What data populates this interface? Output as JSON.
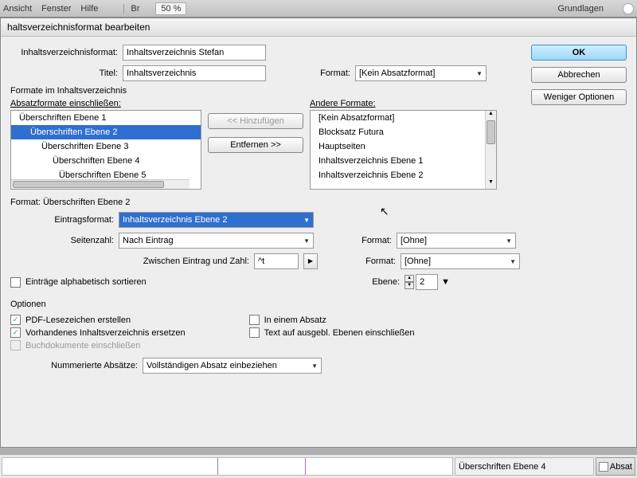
{
  "menubar": {
    "items": [
      "Ansicht",
      "Fenster",
      "Hilfe"
    ],
    "right_label": "Grundlagen",
    "zoom": "50 %"
  },
  "dialog": {
    "title": "haltsverzeichnisformat bearbeiten",
    "labels": {
      "tocFormat": "Inhaltsverzeichnisformat:",
      "title": "Titel:",
      "format": "Format:",
      "section1": "Formate im Inhaltsverzeichnis",
      "include": "Absatzformate einschließen:",
      "other": "Andere Formate:",
      "addBtn": "<< Hinzufügen",
      "removeBtn": "Entfernen >>",
      "formatPrefix": "Format: ",
      "entryFormat": "Eintragsformat:",
      "pageNum": "Seitenzahl:",
      "between": "Zwischen Eintrag und Zahl:",
      "level": "Ebene:",
      "alphaSort": "Einträge alphabetisch sortieren",
      "options": "Optionen",
      "pdf": "PDF-Lesezeichen erstellen",
      "replace": "Vorhandenes Inhaltsverzeichnis ersetzen",
      "bookdocs": "Buchdokumente einschließen",
      "singlePara": "In einem Absatz",
      "hiddenLayers": "Text auf ausgebl. Ebenen einschließen",
      "numPara": "Nummerierte Absätze:"
    },
    "values": {
      "tocFormat": "Inhaltsverzeichnis Stefan",
      "title": "Inhaltsverzeichnis",
      "format": "[Kein Absatzformat]",
      "selectedInclude": "Überschriften Ebene 2",
      "entryFormat": "Inhaltsverzeichnis Ebene 2",
      "pageNum": "Nach Eintrag",
      "between": "^t",
      "subFormat": "[Ohne]",
      "level": "2",
      "numPara": "Vollständigen Absatz einbeziehen"
    },
    "includeList": [
      "Überschriften Ebene 1",
      "Überschriften Ebene 2",
      "Überschriften Ebene 3",
      "Überschriften Ebene 4",
      "Überschriften Ebene 5"
    ],
    "otherList": [
      "[Kein Absatzformat]",
      "Blocksatz Futura",
      "Hauptseiten",
      "Inhaltsverzeichnis Ebene 1",
      "Inhaltsverzeichnis Ebene 2"
    ],
    "checks": {
      "pdf": true,
      "replace": true,
      "singlePara": false,
      "hiddenLayers": false,
      "alphaSort": false
    }
  },
  "buttons": {
    "ok": "OK",
    "cancel": "Abbrechen",
    "fewer": "Weniger Optionen"
  },
  "footer": {
    "label": "Überschriften Ebene 4",
    "panel": "Absat"
  }
}
